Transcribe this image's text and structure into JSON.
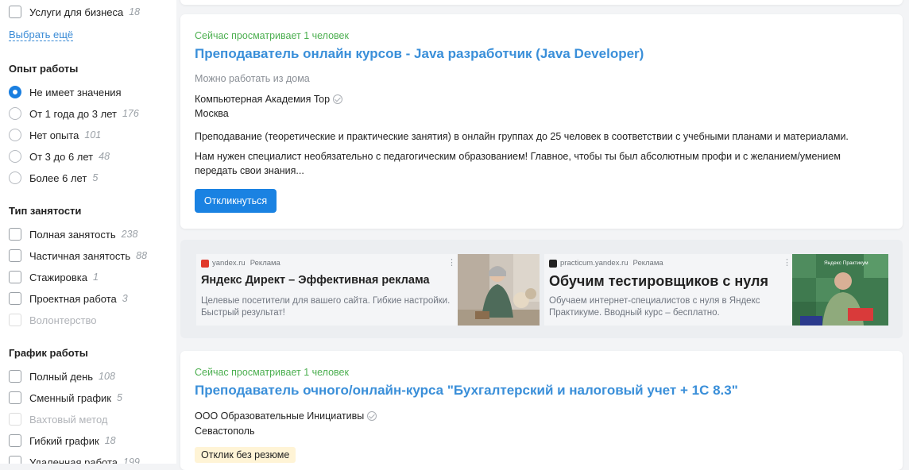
{
  "sidebar": {
    "top_item": {
      "label": "Услуги для бизнеса",
      "count": "18"
    },
    "more_link": "Выбрать ещё",
    "experience": {
      "title": "Опыт работы",
      "options": [
        {
          "label": "Не имеет значения",
          "count": "",
          "selected": true
        },
        {
          "label": "От 1 года до 3 лет",
          "count": "176"
        },
        {
          "label": "Нет опыта",
          "count": "101"
        },
        {
          "label": "От 3 до 6 лет",
          "count": "48"
        },
        {
          "label": "Более 6 лет",
          "count": "5"
        }
      ]
    },
    "employment": {
      "title": "Тип занятости",
      "options": [
        {
          "label": "Полная занятость",
          "count": "238"
        },
        {
          "label": "Частичная занятость",
          "count": "88"
        },
        {
          "label": "Стажировка",
          "count": "1"
        },
        {
          "label": "Проектная работа",
          "count": "3"
        },
        {
          "label": "Волонтерство",
          "count": "",
          "disabled": true
        }
      ]
    },
    "schedule": {
      "title": "График работы",
      "options": [
        {
          "label": "Полный день",
          "count": "108"
        },
        {
          "label": "Сменный график",
          "count": "5"
        },
        {
          "label": "Вахтовый метод",
          "count": "",
          "disabled": true
        },
        {
          "label": "Гибкий график",
          "count": "18"
        },
        {
          "label": "Удаленная работа",
          "count": "199"
        }
      ]
    }
  },
  "vacancy1": {
    "viewing": "Сейчас просматривает 1 человек",
    "title": "Преподаватель онлайн курсов - Java разработчик (Java Developer)",
    "remote": "Можно работать из дома",
    "company": "Компьютерная Академия Top",
    "city": "Москва",
    "desc1": "Преподавание (теоретические и практические занятия) в онлайн группах до 25 человек в соответствии с учебными планами и материалами.",
    "desc2": "Нам нужен специалист необязательно с педагогическим образованием! Главное, чтобы ты был абсолютным профи и с желанием/умением передать свои знания...",
    "respond_button": "Откликнуться"
  },
  "ads": [
    {
      "domain": "yandex.ru",
      "label": "Реклама",
      "title": "Яндекс Директ – Эффективная реклама",
      "text": "Целевые посетители для вашего сайта. Гибкие настройки. Быстрый результат!",
      "more": "⋮"
    },
    {
      "domain": "practicum.yandex.ru",
      "label": "Реклама",
      "title": "Обучим тестировщиков с нуля",
      "text": "Обучаем интернет-специалистов с нуля в Яндекс Практикуме. Вводный курс – бесплатно.",
      "more": "⋮",
      "image_caption": "Яндекс Практикум"
    }
  ],
  "vacancy2": {
    "viewing": "Сейчас просматривает 1 человек",
    "title": "Преподаватель очного/онлайн-курса \"Бухгалтерский и налоговый учет + 1С 8.3\"",
    "company": "ООО Образовательные Инициативы",
    "city": "Севастополь",
    "no_resume_tag": "Отклик без резюме"
  },
  "colors": {
    "accent": "#1a82e2",
    "link": "#3a8fd9",
    "viewing_green": "#4caf50"
  }
}
